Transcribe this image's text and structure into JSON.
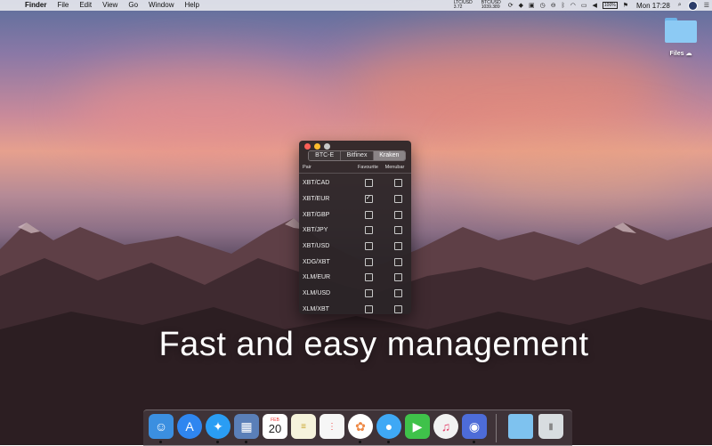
{
  "menubar": {
    "apple_icon": "apple-icon",
    "app_name": "Finder",
    "menus": [
      "File",
      "Edit",
      "View",
      "Go",
      "Window",
      "Help"
    ],
    "tickers": [
      {
        "pair": "LTC/USD",
        "price": "3.72"
      },
      {
        "pair": "BTC/USD",
        "price": "1039.389"
      }
    ],
    "battery": "100%",
    "clock": "Mon 17:28"
  },
  "desktop": {
    "files_label": "Files"
  },
  "window": {
    "tabs": [
      "BTC-E",
      "Bitfinex",
      "Kraken"
    ],
    "active_tab": "Kraken",
    "columns": {
      "pair": "Pair",
      "favourite": "Favourite",
      "menubar": "Menubar"
    },
    "rows": [
      {
        "pair": "XBT/CAD",
        "favourite": false,
        "menubar": false
      },
      {
        "pair": "XBT/EUR",
        "favourite": true,
        "menubar": false
      },
      {
        "pair": "XBT/GBP",
        "favourite": false,
        "menubar": false
      },
      {
        "pair": "XBT/JPY",
        "favourite": false,
        "menubar": false
      },
      {
        "pair": "XBT/USD",
        "favourite": false,
        "menubar": false
      },
      {
        "pair": "XDG/XBT",
        "favourite": false,
        "menubar": false
      },
      {
        "pair": "XLM/EUR",
        "favourite": false,
        "menubar": false
      },
      {
        "pair": "XLM/USD",
        "favourite": false,
        "menubar": false
      },
      {
        "pair": "XLM/XBT",
        "favourite": false,
        "menubar": false
      }
    ]
  },
  "tagline": "Fast and easy management",
  "dock": {
    "calendar_month": "FEB",
    "calendar_day": "20",
    "items": [
      {
        "name": "finder",
        "color": "#3b8fe0"
      },
      {
        "name": "app-store",
        "color": "#2f86f0"
      },
      {
        "name": "safari",
        "color": "#2a9df4"
      },
      {
        "name": "preview",
        "color": "#5a7fb8"
      },
      {
        "name": "calendar",
        "color": "#ffffff"
      },
      {
        "name": "notes",
        "color": "#f6f3dc"
      },
      {
        "name": "reminders",
        "color": "#f6f6f6"
      },
      {
        "name": "photos",
        "color": "#ffffff"
      },
      {
        "name": "messages",
        "color": "#3fa8f5"
      },
      {
        "name": "facetime",
        "color": "#3fc24a"
      },
      {
        "name": "itunes",
        "color": "#f2f2f2"
      },
      {
        "name": "tweetbot",
        "color": "#4d6cd8"
      },
      {
        "name": "downloads-folder",
        "color": "#7ec2ef"
      },
      {
        "name": "trash",
        "color": "#d8dde0"
      }
    ]
  }
}
